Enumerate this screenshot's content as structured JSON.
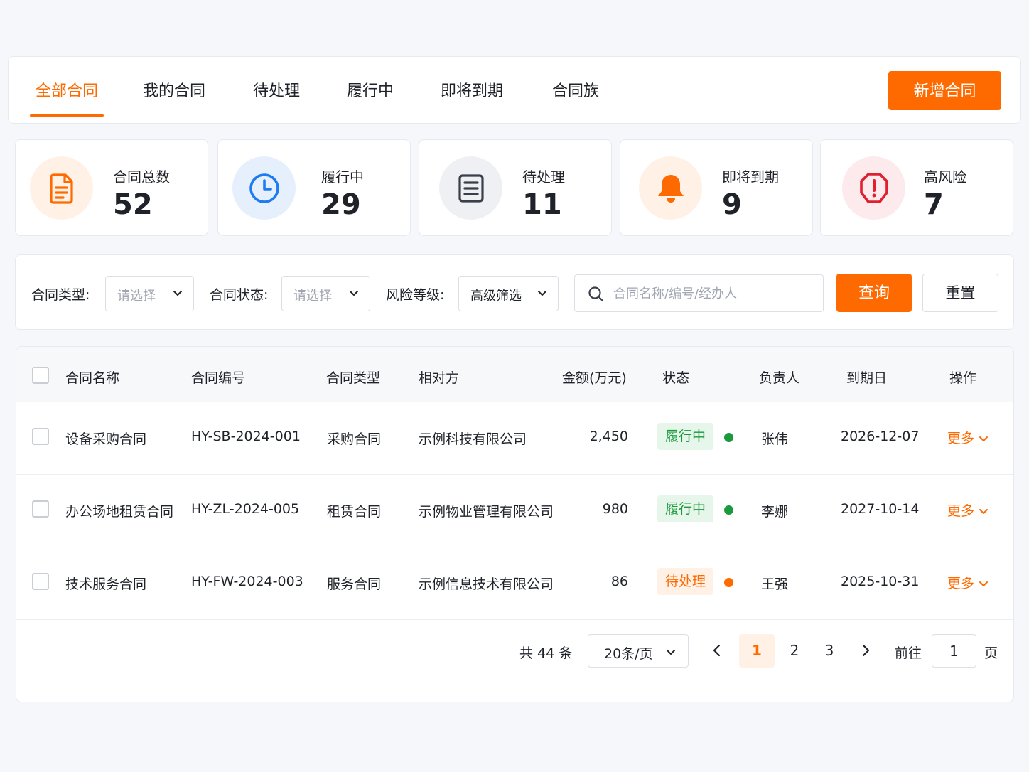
{
  "tabs": [
    {
      "label": "全部合同",
      "active": true
    },
    {
      "label": "我的合同"
    },
    {
      "label": "待处理"
    },
    {
      "label": "履行中"
    },
    {
      "label": "即将到期"
    },
    {
      "label": "合同族"
    }
  ],
  "add_button": "新增合同",
  "stats": [
    {
      "label": "合同总数",
      "value": "52",
      "icon": "document-icon",
      "color": "#ff6a00",
      "bg": "#fff1e6"
    },
    {
      "label": "履行中",
      "value": "29",
      "icon": "clock-icon",
      "color": "#1e7bf0",
      "bg": "#e6f0fd"
    },
    {
      "label": "待处理",
      "value": "11",
      "icon": "list-document-icon",
      "color": "#3a3f4b",
      "bg": "#eef0f3"
    },
    {
      "label": "即将到期",
      "value": "9",
      "icon": "bell-icon",
      "color": "#ff6a00",
      "bg": "#fff1e6"
    },
    {
      "label": "高风险",
      "value": "7",
      "icon": "shield-alert-icon",
      "color": "#e0202f",
      "bg": "#fdeaec"
    }
  ],
  "filters": {
    "type_label": "合同类型:",
    "type_value": "请选择",
    "status_label": "合同状态:",
    "status_value": "请选择",
    "risk_label": "风险等级:",
    "risk_value": "高级筛选",
    "search_placeholder": "合同名称/编号/经办人",
    "query_button": "查询",
    "reset_button": "重置"
  },
  "table": {
    "headers": [
      "合同名称",
      "合同编号",
      "合同类型",
      "相对方",
      "金额(万元)",
      "状态",
      "负责人",
      "到期日",
      "操作"
    ],
    "rows": [
      {
        "name": "设备采购合同",
        "code": "HY-SB-2024-001",
        "type": "采购合同",
        "party": "示例科技有限公司",
        "amount": "2,450",
        "status": "履行中",
        "status_color": "#1a9a3c",
        "status_bg": "#e7f6ea",
        "owner": "张伟",
        "due": "2026-12-07",
        "action": "更多"
      },
      {
        "name": "办公场地租赁合同",
        "code": "HY-ZL-2024-005",
        "type": "租赁合同",
        "party": "示例物业管理有限公司",
        "amount": "980",
        "status": "履行中",
        "status_color": "#1a9a3c",
        "status_bg": "#e7f6ea",
        "owner": "李娜",
        "due": "2027-10-14",
        "action": "更多"
      },
      {
        "name": "技术服务合同",
        "code": "HY-FW-2024-003",
        "type": "服务合同",
        "party": "示例信息技术有限公司",
        "amount": "86",
        "status": "待处理",
        "status_color": "#ff6a00",
        "status_bg": "#fff1e6",
        "owner": "王强",
        "due": "2025-10-31",
        "action": "更多"
      }
    ]
  },
  "pagination": {
    "total": "共 44 条",
    "page_size": "20条/页",
    "pages": [
      "1",
      "2",
      "3"
    ],
    "current": "1",
    "goto_label": "前往",
    "goto_value": "1",
    "page_suffix": "页"
  },
  "colors": {
    "accent": "#ff6a00",
    "green": "#1a9a3c"
  }
}
